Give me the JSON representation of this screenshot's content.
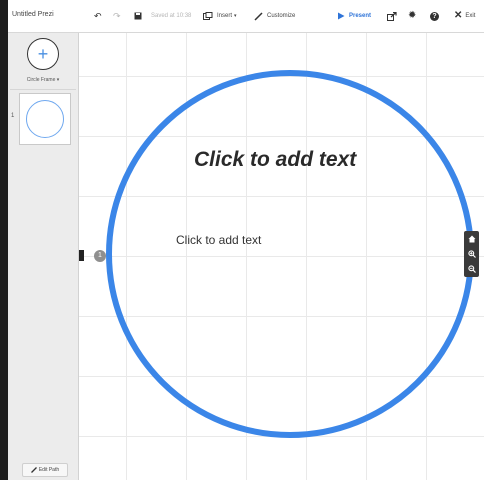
{
  "app": {
    "title": "Untitled Prezi"
  },
  "toolbar": {
    "saved_text": "Saved at 10:38",
    "insert_label": "Insert",
    "customize_label": "Customize",
    "present_label": "Present",
    "exit_label": "Exit",
    "icons": [
      "undo-icon",
      "redo-icon",
      "save-icon",
      "insert-icon",
      "customize-brush-icon",
      "present-play-icon",
      "share-icon",
      "settings-gear-icon",
      "help-icon",
      "exit-x-icon"
    ],
    "present_color": "#2f74d8"
  },
  "sidebar": {
    "add_symbol": "+",
    "frame_type_label": "Circle Frame",
    "thumbnail_number": "1",
    "edit_path_label": "Edit Path"
  },
  "canvas": {
    "title_placeholder": "Click to add text",
    "body_placeholder": "Click to add text",
    "path_step_number": "1",
    "frame_color": "#3b86e8",
    "zoom_controls": [
      "home-icon",
      "zoom-in-icon",
      "zoom-out-icon"
    ]
  }
}
